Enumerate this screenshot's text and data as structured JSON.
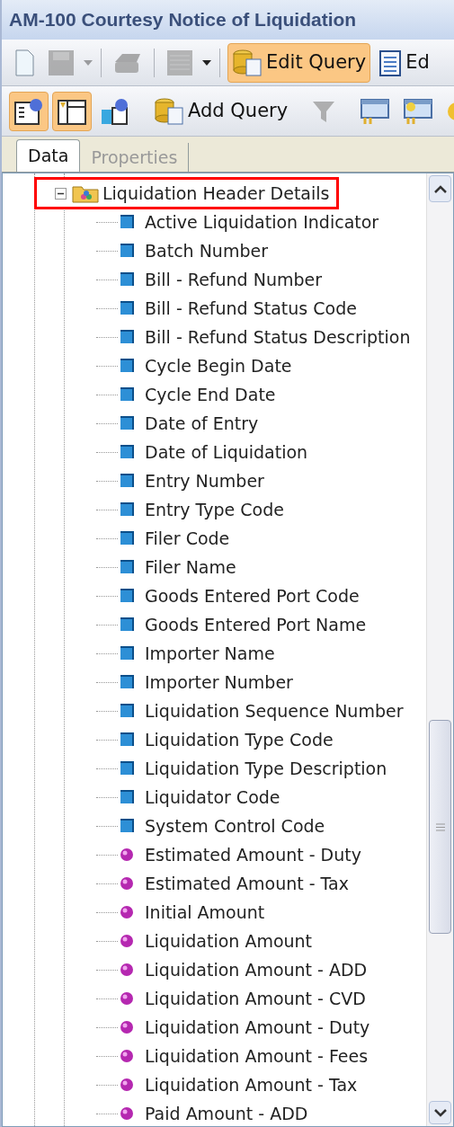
{
  "window": {
    "title": "AM-100 Courtesy Notice of Liquidation"
  },
  "toolbar": [
    {
      "kind": "new"
    },
    {
      "kind": "save",
      "disabled": true
    },
    {
      "kind": "caret",
      "disabled": true
    },
    {
      "kind": "sep"
    },
    {
      "kind": "print",
      "disabled": true
    },
    {
      "kind": "sep"
    },
    {
      "kind": "grid",
      "disabled": true
    },
    {
      "kind": "caret",
      "disabled": false
    },
    {
      "kind": "sep"
    },
    {
      "kind": "query",
      "label": "Edit Query",
      "selected": true
    },
    {
      "kind": "doc",
      "label": "Ed",
      "selected": false
    }
  ],
  "toolbar2": [
    {
      "kind": "grip"
    },
    {
      "kind": "view1",
      "selected": true
    },
    {
      "kind": "view2",
      "selected": true
    },
    {
      "kind": "view3",
      "selected": false
    },
    {
      "kind": "sep"
    },
    {
      "kind": "query",
      "label": "Add Query",
      "selected": false
    },
    {
      "kind": "sep"
    },
    {
      "kind": "filter",
      "disabled": true
    },
    {
      "kind": "sep"
    },
    {
      "kind": "panel"
    },
    {
      "kind": "panel2"
    },
    {
      "kind": "coin"
    }
  ],
  "tabs": [
    {
      "label": "Data",
      "selected": true
    },
    {
      "label": "Properties",
      "selected": false
    }
  ],
  "tree": [
    {
      "label": "Liquidation Header Details",
      "expanded": true,
      "highlighted": true,
      "children": [
        {
          "label": "Active Liquidation Indicator",
          "kind": "dimension"
        },
        {
          "label": "Batch Number",
          "kind": "dimension"
        },
        {
          "label": "Bill - Refund Number",
          "kind": "dimension"
        },
        {
          "label": "Bill - Refund Status Code",
          "kind": "dimension"
        },
        {
          "label": "Bill - Refund Status Description",
          "kind": "dimension"
        },
        {
          "label": "Cycle Begin Date",
          "kind": "dimension"
        },
        {
          "label": "Cycle End Date",
          "kind": "dimension"
        },
        {
          "label": "Date of Entry",
          "kind": "dimension"
        },
        {
          "label": "Date of Liquidation",
          "kind": "dimension"
        },
        {
          "label": "Entry Number",
          "kind": "dimension"
        },
        {
          "label": "Entry Type Code",
          "kind": "dimension"
        },
        {
          "label": "Filer Code",
          "kind": "dimension"
        },
        {
          "label": "Filer Name",
          "kind": "dimension"
        },
        {
          "label": "Goods Entered Port Code",
          "kind": "dimension"
        },
        {
          "label": "Goods Entered Port Name",
          "kind": "dimension"
        },
        {
          "label": "Importer Name",
          "kind": "dimension"
        },
        {
          "label": "Importer Number",
          "kind": "dimension"
        },
        {
          "label": "Liquidation Sequence Number",
          "kind": "dimension"
        },
        {
          "label": "Liquidation Type Code",
          "kind": "dimension"
        },
        {
          "label": "Liquidation Type Description",
          "kind": "dimension"
        },
        {
          "label": "Liquidator Code",
          "kind": "dimension"
        },
        {
          "label": "System Control Code",
          "kind": "dimension"
        },
        {
          "label": "Estimated Amount - Duty",
          "kind": "measure"
        },
        {
          "label": "Estimated Amount - Tax",
          "kind": "measure"
        },
        {
          "label": "Initial Amount",
          "kind": "measure"
        },
        {
          "label": "Liquidation Amount",
          "kind": "measure"
        },
        {
          "label": "Liquidation Amount - ADD",
          "kind": "measure"
        },
        {
          "label": "Liquidation Amount - CVD",
          "kind": "measure"
        },
        {
          "label": "Liquidation Amount - Duty",
          "kind": "measure"
        },
        {
          "label": "Liquidation Amount - Fees",
          "kind": "measure"
        },
        {
          "label": "Liquidation Amount - Tax",
          "kind": "measure"
        },
        {
          "label": "Paid Amount - ADD",
          "kind": "measure"
        }
      ]
    }
  ]
}
